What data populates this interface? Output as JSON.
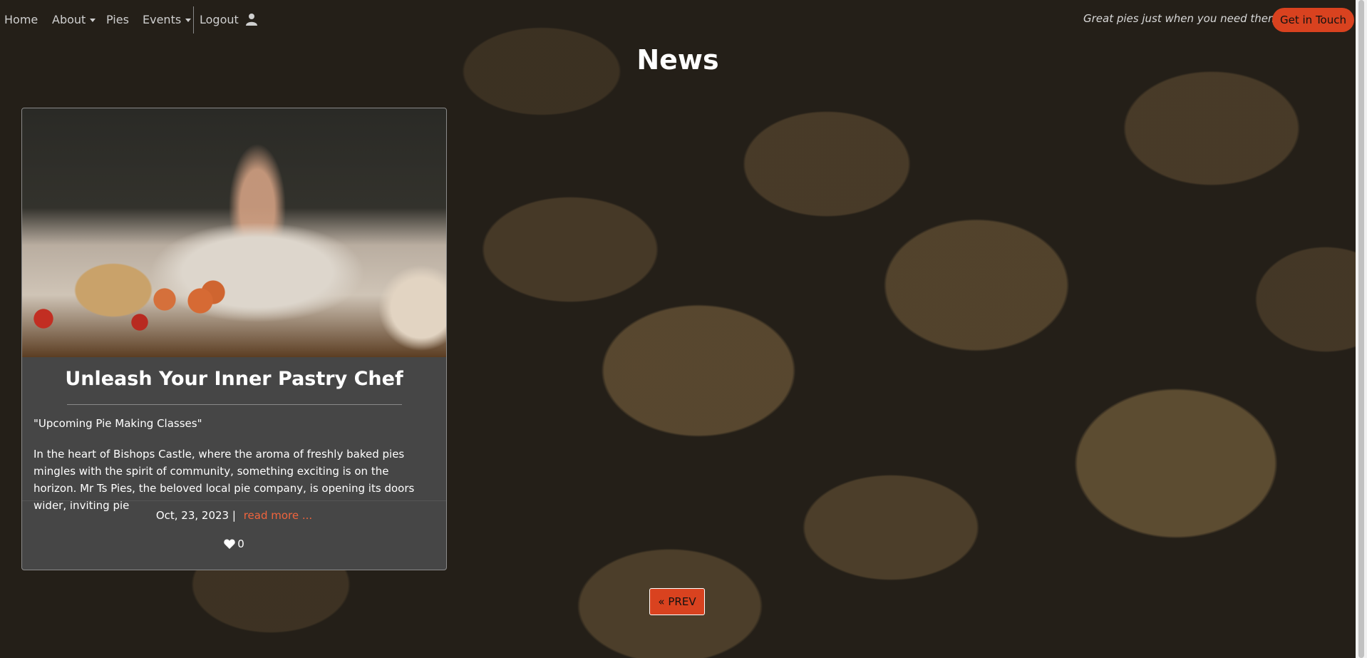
{
  "nav": {
    "home": "Home",
    "about": "About",
    "pies": "Pies",
    "events": "Events",
    "logout": "Logout",
    "tagline": "Great pies just when you need them!",
    "cta": "Get in Touch"
  },
  "page": {
    "title": "News"
  },
  "article": {
    "title": "Unleash Your Inner Pastry Chef",
    "subtitle": "\"Upcoming Pie Making Classes\"",
    "excerpt": "In the heart of Bishops Castle, where the aroma of freshly baked pies mingles with the spirit of community, something exciting is on the horizon. Mr Ts Pies, the beloved local pie company, is opening its doors wider, inviting pie",
    "date": "Oct, 23, 2023 |",
    "read_more": "read more ...",
    "likes": "0"
  },
  "pagination": {
    "prev": "« PREV"
  },
  "colors": {
    "accent": "#d9421f",
    "link": "#f0643d",
    "card_bg": "#464646"
  },
  "icons": [
    "user-icon",
    "heart-icon",
    "caret-down-icon"
  ]
}
